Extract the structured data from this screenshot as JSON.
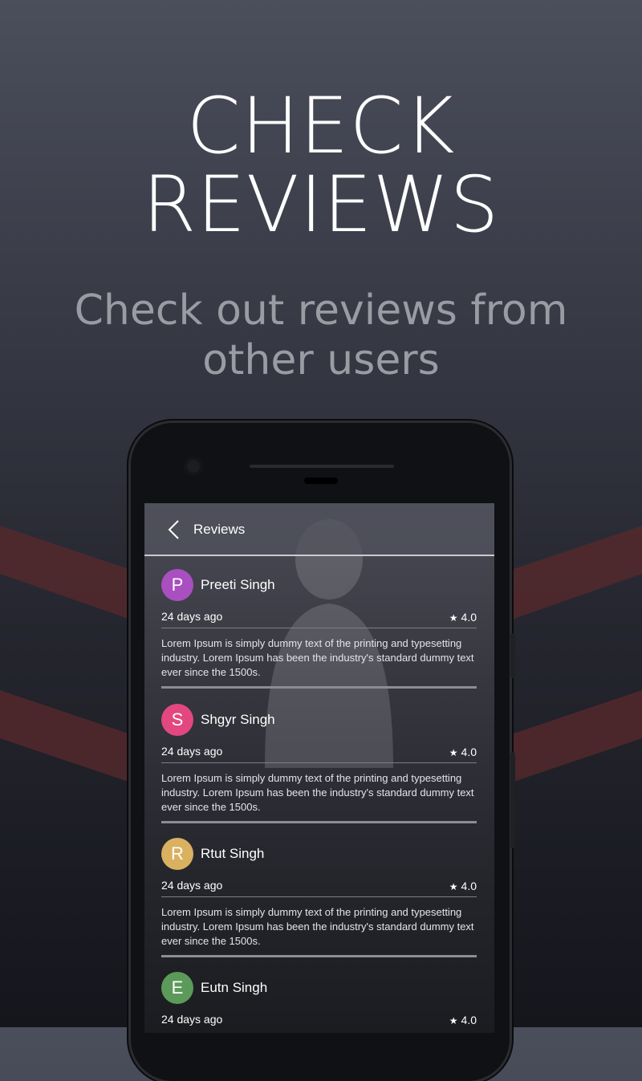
{
  "headline": {
    "line1": "CHECK",
    "line2": "REVIEWS"
  },
  "subtitle": "Check out reviews from other users",
  "appbar": {
    "title": "Reviews",
    "back_icon": "chevron-left-icon"
  },
  "reviews": [
    {
      "initial": "P",
      "name": "Preeti Singh",
      "date": "24 days ago",
      "rating": "4.0",
      "avatar_color": "#a94fc0",
      "text": "Lorem Ipsum is simply dummy text of the printing and typesetting industry. Lorem Ipsum has been the industry's standard dummy text ever since the 1500s."
    },
    {
      "initial": "S",
      "name": "Shgyr Singh",
      "date": "24 days ago",
      "rating": "4.0",
      "avatar_color": "#e2477f",
      "text": "Lorem Ipsum is simply dummy text of the printing and typesetting industry. Lorem Ipsum has been the industry's standard dummy text ever since the 1500s."
    },
    {
      "initial": "R",
      "name": "Rtut Singh",
      "date": "24 days ago",
      "rating": "4.0",
      "avatar_color": "#d9b160",
      "text": "Lorem Ipsum is simply dummy text of the printing and typesetting industry. Lorem Ipsum has been the industry's standard dummy text ever since the 1500s."
    },
    {
      "initial": "E",
      "name": "Eutn Singh",
      "date": "24 days ago",
      "rating": "4.0",
      "avatar_color": "#5c9a5a",
      "text": ""
    }
  ],
  "colors": {
    "stripe": "#5a2a2c",
    "accent_white": "#ffffff"
  }
}
